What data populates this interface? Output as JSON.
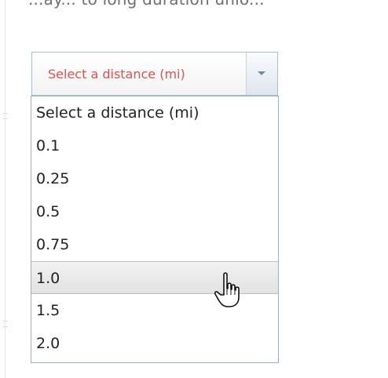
{
  "heading_fragment": "...ay... to long duration unlo...",
  "select": {
    "value": "Select a distance (mi)",
    "value_color": "#d9534f",
    "arrow_icon": "chevron-down-icon",
    "options": [
      "Select a distance (mi)",
      "0.1",
      "0.25",
      "0.5",
      "0.75",
      "1.0",
      "1.5",
      "2.0"
    ],
    "hovered_option": "1.0"
  },
  "cursor_icon": "hand-pointer-icon"
}
